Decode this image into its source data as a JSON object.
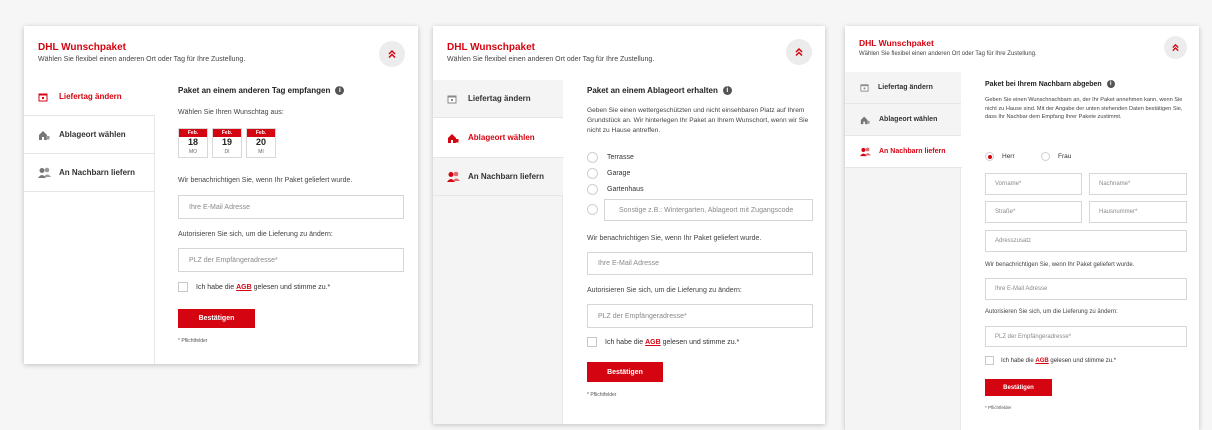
{
  "brand": {
    "title": "DHL Wunschpaket",
    "subtitle": "Wählen Sie flexibel einen anderen Ort oder Tag für Ihre Zustellung.",
    "accent_color": "#d40511"
  },
  "nav": [
    {
      "label": "Liefertag ändern",
      "icon": "calendar-icon"
    },
    {
      "label": "Ablageort wählen",
      "icon": "drop-place-icon"
    },
    {
      "label": "An Nachbarn liefern",
      "icon": "neighbor-icon"
    }
  ],
  "panel1": {
    "title": "Paket an einem anderen Tag empfangen",
    "choose_label": "Wählen Sie Ihren Wunschtag aus:",
    "dates": [
      {
        "month": "Feb.",
        "day": "18",
        "weekday": "MO"
      },
      {
        "month": "Feb.",
        "day": "19",
        "weekday": "DI"
      },
      {
        "month": "Feb.",
        "day": "20",
        "weekday": "MI"
      }
    ]
  },
  "panel2": {
    "title": "Paket an einem Ablageort erhalten",
    "description": "Geben Sie einen wettergeschützten und nicht einsehbaren Platz auf Ihrem Grundstück an. Wir hinterlegen Ihr Paket an Ihrem Wunschort, wenn wir Sie nicht zu Hause antreffen.",
    "options": [
      "Terrasse",
      "Garage",
      "Gartenhaus"
    ],
    "other_placeholder": "Sonstige z.B.: Wintergarten, Ablageort mit Zugangscode"
  },
  "panel3": {
    "title": "Paket bei Ihrem Nachbarn abgeben",
    "description": "Geben Sie einen Wunschnachbarn an, der Ihr Paket annehmen kann, wenn Sie nicht zu Hause sind. Mit der Angabe der unten stehenden Daten bestätigen Sie, dass Ihr Nachbar dem Empfang Ihrer Pakete zustimmt.",
    "salutation": [
      "Herr",
      "Frau"
    ],
    "fields": {
      "firstname": "Vorname*",
      "lastname": "Nachname*",
      "street": "Straße*",
      "housenumber": "Hausnummer*",
      "addition": "Adresszusatz"
    }
  },
  "common": {
    "notify_label": "Wir benachrichtigen Sie, wenn Ihr Paket geliefert wurde.",
    "email_placeholder": "Ihre E-Mail Adresse",
    "auth_label": "Autorisieren Sie sich, um die Lieferung zu ändern:",
    "plz_placeholder": "PLZ der Empfängeradresse*",
    "agb_pre": "Ich habe die ",
    "agb_link": "AGB",
    "agb_post": " gelesen und stimme zu.*",
    "submit": "Bestätigen",
    "required_note": "* Pflichtfelder"
  }
}
